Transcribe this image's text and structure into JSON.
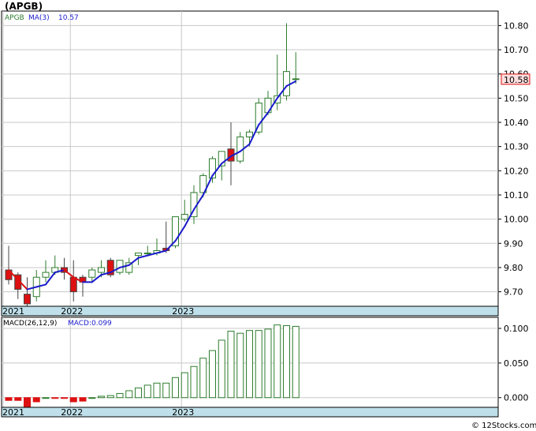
{
  "title": "(APGB)",
  "watermark": "© 12Stocks.com",
  "colors": {
    "up": "#2e7d2e",
    "down": "#dd1111",
    "ma": "#1a1acc",
    "ma_down": "#dd1111",
    "axis_band": "#bfe0ea",
    "grid": "#c8c8c8",
    "frame": "#000000",
    "last_price_bg": "#fde0e0"
  },
  "chart_data": [
    {
      "type": "candlestick",
      "name": "price",
      "legend": {
        "ticker": "APGB",
        "ma_label": "MA(3)",
        "ma_value": "10.57"
      },
      "last_price_label": "10.58",
      "ylim": [
        9.64,
        10.86
      ],
      "y_ticks": [
        "9.70",
        "9.80",
        "9.90",
        "10.00",
        "10.10",
        "10.20",
        "10.30",
        "10.40",
        "10.50",
        "10.60",
        "10.70",
        "10.80"
      ],
      "x_labels": [
        {
          "label": "2021",
          "index": 0
        },
        {
          "label": "2022",
          "index": 7
        },
        {
          "label": "2023",
          "index": 19
        }
      ],
      "grid": true,
      "candles": [
        {
          "o": 9.79,
          "h": 9.89,
          "l": 9.73,
          "c": 9.75
        },
        {
          "o": 9.77,
          "h": 9.78,
          "l": 9.67,
          "c": 9.71
        },
        {
          "o": 9.69,
          "h": 9.76,
          "l": 9.64,
          "c": 9.65
        },
        {
          "o": 9.68,
          "h": 9.79,
          "l": 9.66,
          "c": 9.76
        },
        {
          "o": 9.76,
          "h": 9.83,
          "l": 9.74,
          "c": 9.78
        },
        {
          "o": 9.78,
          "h": 9.85,
          "l": 9.77,
          "c": 9.8
        },
        {
          "o": 9.8,
          "h": 9.84,
          "l": 9.75,
          "c": 9.78
        },
        {
          "o": 9.76,
          "h": 9.83,
          "l": 9.66,
          "c": 9.7
        },
        {
          "o": 9.76,
          "h": 9.77,
          "l": 9.68,
          "c": 9.74
        },
        {
          "o": 9.76,
          "h": 9.8,
          "l": 9.74,
          "c": 9.79
        },
        {
          "o": 9.78,
          "h": 9.83,
          "l": 9.76,
          "c": 9.8
        },
        {
          "o": 9.83,
          "h": 9.84,
          "l": 9.76,
          "c": 9.77
        },
        {
          "o": 9.78,
          "h": 9.83,
          "l": 9.77,
          "c": 9.83
        },
        {
          "o": 9.78,
          "h": 9.84,
          "l": 9.77,
          "c": 9.82
        },
        {
          "o": 9.85,
          "h": 9.86,
          "l": 9.81,
          "c": 9.86
        },
        {
          "o": 9.86,
          "h": 9.89,
          "l": 9.85,
          "c": 9.86
        },
        {
          "o": 9.86,
          "h": 9.92,
          "l": 9.85,
          "c": 9.87
        },
        {
          "o": 9.88,
          "h": 9.99,
          "l": 9.86,
          "c": 9.87
        },
        {
          "o": 9.89,
          "h": 10.01,
          "l": 9.88,
          "c": 10.01
        },
        {
          "o": 10.0,
          "h": 10.08,
          "l": 9.99,
          "c": 10.02
        },
        {
          "o": 10.01,
          "h": 10.14,
          "l": 9.98,
          "c": 10.11
        },
        {
          "o": 10.11,
          "h": 10.19,
          "l": 10.09,
          "c": 10.18
        },
        {
          "o": 10.17,
          "h": 10.26,
          "l": 10.15,
          "c": 10.25
        },
        {
          "o": 10.22,
          "h": 10.28,
          "l": 10.16,
          "c": 10.28
        },
        {
          "o": 10.29,
          "h": 10.4,
          "l": 10.14,
          "c": 10.24
        },
        {
          "o": 10.24,
          "h": 10.36,
          "l": 10.23,
          "c": 10.34
        },
        {
          "o": 10.34,
          "h": 10.37,
          "l": 10.3,
          "c": 10.36
        },
        {
          "o": 10.36,
          "h": 10.5,
          "l": 10.35,
          "c": 10.48
        },
        {
          "o": 10.44,
          "h": 10.53,
          "l": 10.43,
          "c": 10.5
        },
        {
          "o": 10.48,
          "h": 10.68,
          "l": 10.45,
          "c": 10.51
        },
        {
          "o": 10.51,
          "h": 10.81,
          "l": 10.49,
          "c": 10.61
        },
        {
          "o": 10.58,
          "h": 10.69,
          "l": 10.56,
          "c": 10.58
        }
      ],
      "ma": [
        9.79,
        9.75,
        9.71,
        9.72,
        9.73,
        9.78,
        9.79,
        9.76,
        9.74,
        9.74,
        9.77,
        9.78,
        9.8,
        9.81,
        9.84,
        9.85,
        9.86,
        9.87,
        9.91,
        9.97,
        10.04,
        10.1,
        10.18,
        10.23,
        10.26,
        10.28,
        10.31,
        10.39,
        10.44,
        10.5,
        10.55,
        10.57
      ]
    },
    {
      "type": "bar",
      "name": "macd",
      "legend": {
        "params": "MACD(26,12,9)",
        "value_label": "MACD:0.099"
      },
      "ylim": [
        -0.014,
        0.116
      ],
      "y_ticks": [
        "0.000",
        "0.050",
        "0.100"
      ],
      "x_labels": [
        {
          "label": "2021",
          "index": 0
        },
        {
          "label": "2022",
          "index": 7
        },
        {
          "label": "2023",
          "index": 19
        }
      ],
      "grid": true,
      "values": [
        -0.004,
        -0.004,
        -0.013,
        -0.006,
        0.0,
        -0.001,
        -0.001,
        -0.006,
        -0.005,
        0.0,
        0.002,
        0.003,
        0.006,
        0.01,
        0.014,
        0.018,
        0.021,
        0.021,
        0.029,
        0.036,
        0.045,
        0.057,
        0.068,
        0.083,
        0.096,
        0.093,
        0.097,
        0.097,
        0.099,
        0.105,
        0.104,
        0.103
      ]
    }
  ]
}
